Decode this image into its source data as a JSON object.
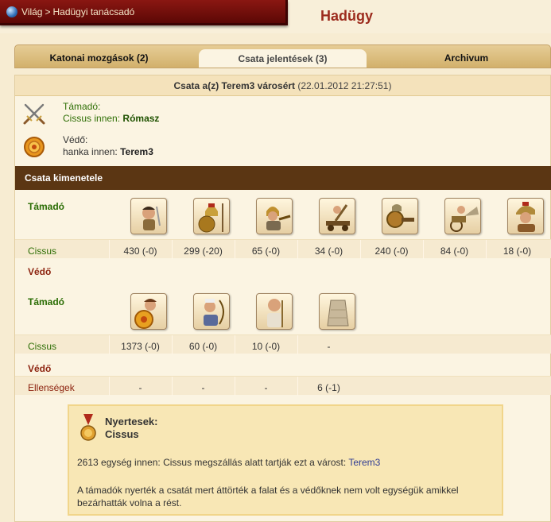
{
  "breadcrumb": {
    "world": "Világ",
    "separator": ">",
    "current": "Hadügyi tanácsadó"
  },
  "page_title": "Hadügy",
  "tabs": [
    {
      "label": "Katonai mozgások (2)"
    },
    {
      "label": "Csata jelentések (3)"
    },
    {
      "label": "Archivum"
    }
  ],
  "report": {
    "title": "Csata a(z) Terem3 városért",
    "date": "(22.01.2012 21:27:51)",
    "attacker": {
      "role": "Támadó:",
      "player": "Cissus",
      "from_word": "innen:",
      "town": "Rómasz"
    },
    "defender": {
      "role": "Védő:",
      "player": "hanka",
      "from_word": "innen:",
      "town": "Terem3"
    }
  },
  "outcome": {
    "title": "Csata kimenetele",
    "attacker_label": "Támadó",
    "attacker_player": "Cissus",
    "attacker_units": [
      {
        "icon": "swordsman-icon",
        "count": "430 (-0)"
      },
      {
        "icon": "hoplite-icon",
        "count": "299 (-20)"
      },
      {
        "icon": "slinger-icon",
        "count": "65 (-0)"
      },
      {
        "icon": "catapult-icon",
        "count": "34 (-0)"
      },
      {
        "icon": "ram-icon",
        "count": "240 (-0)"
      },
      {
        "icon": "chariot-icon",
        "count": "84 (-0)"
      },
      {
        "icon": "horseman-icon",
        "count": "18 (-0)"
      }
    ],
    "defender_label": "Védő",
    "def_attacker_label": "Támadó",
    "def_attacker_player": "Cissus",
    "defender_units": [
      {
        "icon": "shield-warrior-icon",
        "count": "1373 (-0)"
      },
      {
        "icon": "archer-icon",
        "count": "60 (-0)"
      },
      {
        "icon": "priest-icon",
        "count": "10 (-0)"
      },
      {
        "icon": "wall-icon",
        "count": "-"
      }
    ],
    "enemy_block_label": "Védő",
    "enemies_label": "Ellenségek",
    "enemies_counts": [
      "-",
      "-",
      "-",
      "6 (-1)"
    ]
  },
  "winner": {
    "label": "Nyertesek:",
    "name": "Cissus",
    "occupation_text": "2613 egység innen: Cissus megszállás alatt tartják ezt a várost:",
    "occupation_town": "Terem3",
    "explanation": "A támadók nyerték a csatát mert áttörték a falat és a védőknek nem volt egységük amikkel bezárhatták volna a rést."
  },
  "colors": {
    "header_red": "#7a120d",
    "title_red": "#9c2b1d",
    "section_brown": "#5b3613",
    "attacker_green": "#2a6d04",
    "defender_red": "#8d2410"
  }
}
